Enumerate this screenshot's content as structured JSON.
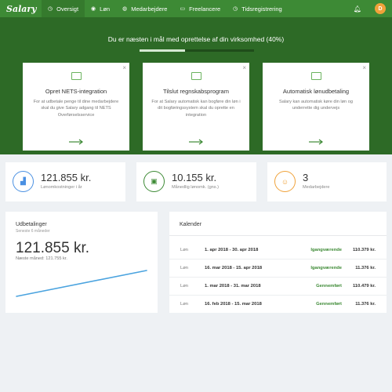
{
  "nav": {
    "logo": "Salary",
    "tabs": [
      {
        "label": "Oversigt",
        "icon": "clock-icon",
        "active": true
      },
      {
        "label": "Løn",
        "icon": "coins-icon"
      },
      {
        "label": "Medarbejdere",
        "icon": "users-icon"
      },
      {
        "label": "Freelancere",
        "icon": "id-card-icon"
      },
      {
        "label": "Tidsregistrering",
        "icon": "clock-icon"
      }
    ],
    "avatar_initial": "D",
    "colors": {
      "bar": "#3d8a35",
      "active_tab": "#357a2d",
      "avatar": "#f0a23a"
    }
  },
  "hero": {
    "title": "Du er næsten i mål med oprettelse af din virksomhed (40%)",
    "progress": 0.4,
    "cards": [
      {
        "title": "Opret NETS-integration",
        "desc": "For at udbetale penge til dine medarbejdere skal du give Salary adgang til NETS Overførselsservice",
        "icon": "bank-card-icon"
      },
      {
        "title": "Tilslut regnskabsprogram",
        "desc": "For at Salary automatisk kan bogføre din løn i dit bogføringssystem skal du oprette en integration",
        "icon": "upload-icon"
      },
      {
        "title": "Automatisk lønudbetaling",
        "desc": "Salary kan automatisk køre din løn og underrette dig undervejs",
        "icon": "money-icon"
      }
    ]
  },
  "stats": [
    {
      "value": "121.855 kr.",
      "label": "Lønomkostninger i år",
      "icon": "bar-chart-icon",
      "color": "#4a90e2"
    },
    {
      "value": "10.155 kr.",
      "label": "Månedlig lønomk. (gns.)",
      "icon": "image-icon",
      "color": "#3d8a35"
    },
    {
      "value": "3",
      "label": "Medarbejdere",
      "icon": "person-icon",
      "color": "#f0a23a"
    }
  ],
  "payouts": {
    "title": "Udbetalinger",
    "subtitle": "Seneste 6 måneder",
    "value": "121.855 kr.",
    "next": "Næste måned: 121.755 kr.",
    "line_color": "#4aa3df"
  },
  "calendar": {
    "title": "Kalender",
    "rows": [
      {
        "type": "Løn",
        "dates": "1. apr 2018 - 30. apr 2018",
        "status": "Igangværende",
        "amount": "110.379 kr."
      },
      {
        "type": "Løn",
        "dates": "16. mar 2018 - 15. apr 2018",
        "status": "Igangværende",
        "amount": "11.376 kr."
      },
      {
        "type": "Løn",
        "dates": "1. mar 2018 - 31. mar 2018",
        "status": "Gennemført",
        "amount": "110.479 kr."
      },
      {
        "type": "Løn",
        "dates": "16. feb 2018 - 15. mar 2018",
        "status": "Gennemført",
        "amount": "11.376 kr."
      }
    ]
  }
}
